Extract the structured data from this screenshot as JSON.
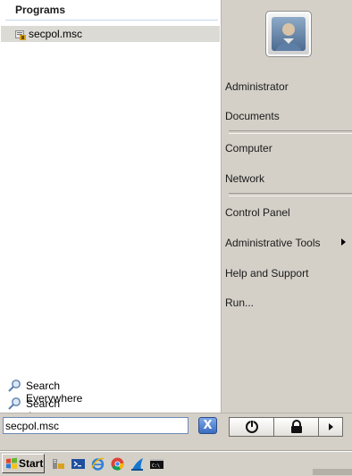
{
  "left_pane": {
    "programs_header": "Programs",
    "results": [
      {
        "label": "secpol.msc",
        "icon": "secpol-app-icon"
      }
    ],
    "search_links": [
      {
        "label": "Search Everywhere",
        "icon": "search-icon"
      },
      {
        "label": "Search the Internet",
        "icon": "search-icon"
      }
    ]
  },
  "right_pane": {
    "user_picture": "user-avatar",
    "items": [
      {
        "label": "Administrator"
      },
      {
        "label": "Documents"
      },
      {
        "label": "Computer"
      },
      {
        "label": "Network"
      },
      {
        "label": "Control Panel"
      },
      {
        "label": "Administrative Tools",
        "has_submenu": true
      },
      {
        "label": "Help and Support"
      },
      {
        "label": "Run..."
      }
    ]
  },
  "search": {
    "value": "secpol.msc",
    "clear_button": "X"
  },
  "power_buttons": {
    "power_icon": "power-icon",
    "lock_icon": "lock-icon",
    "more_icon": "arrow-right-icon"
  },
  "taskbar": {
    "start_label": "Start",
    "quick_launch": [
      "server-manager-icon",
      "powershell-icon",
      "internet-explorer-icon",
      "chrome-icon",
      "wireshark-icon",
      "cmd-icon"
    ]
  },
  "colors": {
    "selection": "#dcdad4",
    "panel": "#d4d0c8",
    "search_border": "#6e8ab8",
    "clear_button": "#3a6cc0"
  }
}
